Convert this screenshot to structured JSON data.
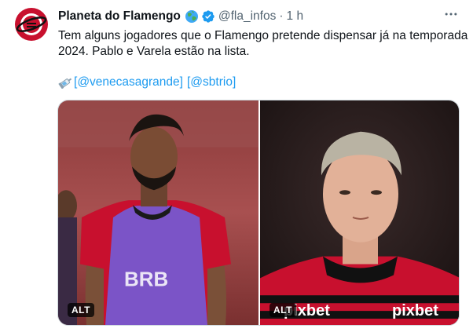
{
  "tweet": {
    "author_name": "Planeta do Flamengo",
    "handle": "@fla_infos",
    "separator": "·",
    "time": "1 h",
    "text_lines": [
      "Tem alguns jogadores que o Flamengo pretende dispensar já na temporada",
      "2024. Pablo e Varela estão na lista."
    ],
    "links": {
      "bracket_open": "[",
      "bracket_close": "]",
      "mention_1": "@venecasagrande",
      "mention_2": "@sbtrio"
    },
    "media": {
      "alt_left": "ALT",
      "alt_right": "ALT",
      "left_shirt_sponsor": "BRB",
      "right_shirt_sponsor_1": "pixbet",
      "right_shirt_sponsor_2": "pixbet"
    }
  },
  "colors": {
    "link": "#1d9bf0",
    "verified": "#1d9bf0",
    "muted": "#536471",
    "flamengo_red": "#c8102e",
    "bib_purple": "#7b54c7"
  },
  "icons": {
    "avatar": "planeta-flamengo-logo",
    "globe": "globe-emoji-icon",
    "verified": "verified-badge-icon",
    "more": "more-options-icon",
    "syringe": "syringe-emoji-icon"
  }
}
